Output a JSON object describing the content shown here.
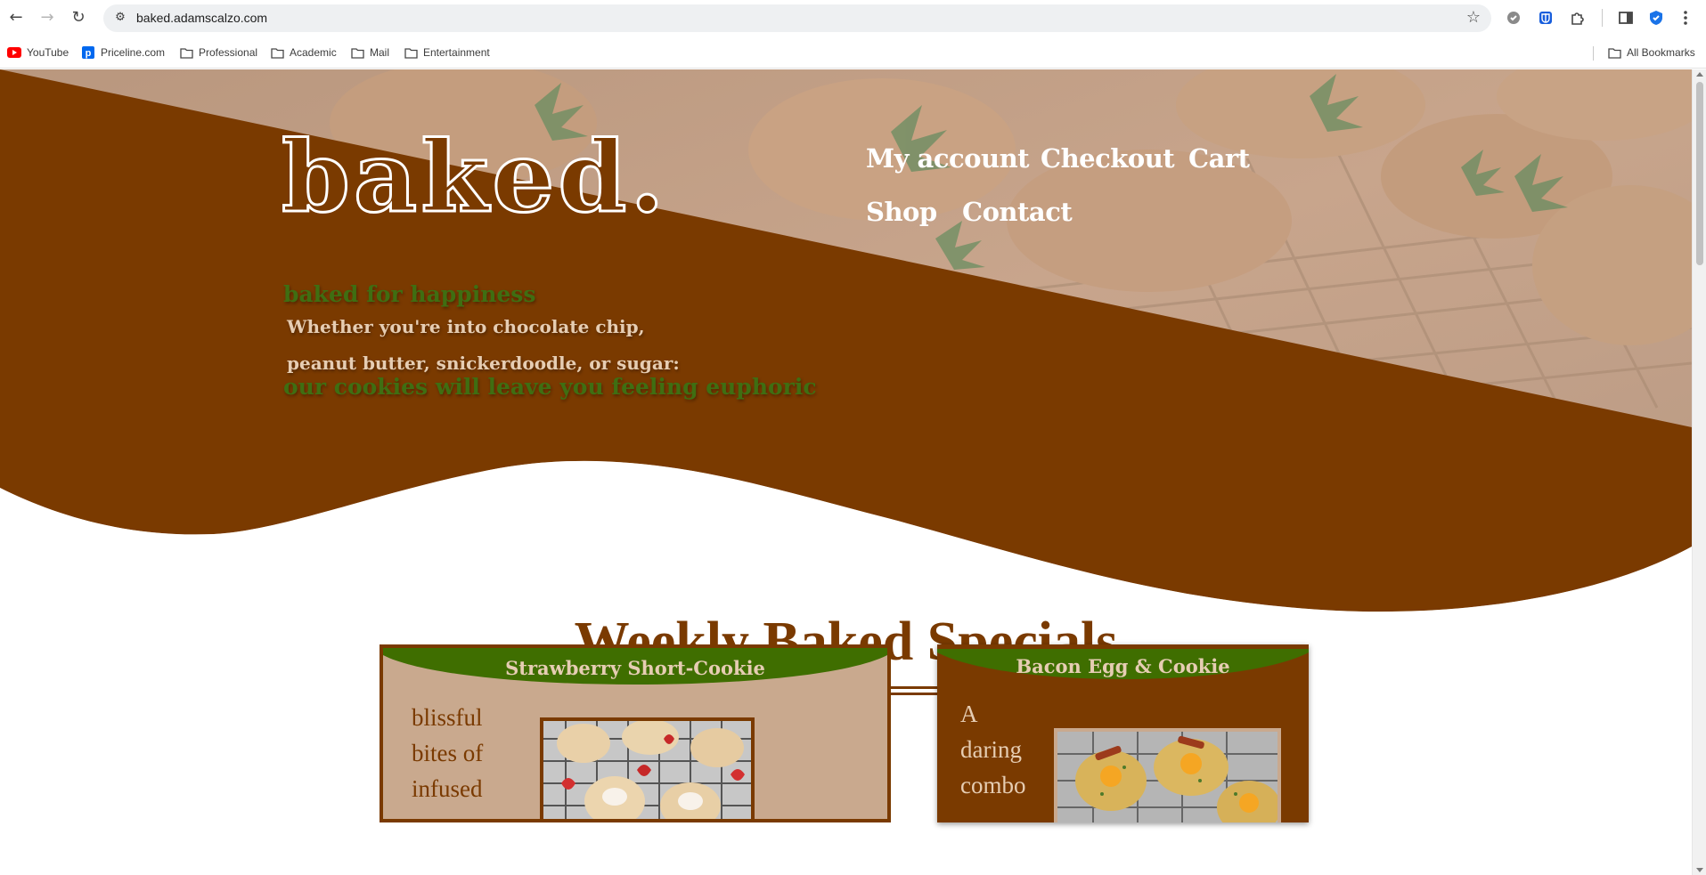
{
  "browser": {
    "url": "baked.adamscalzo.com",
    "bookmarks": [
      {
        "label": "YouTube",
        "icon": "youtube-icon"
      },
      {
        "label": "Priceline.com",
        "icon": "priceline-icon"
      },
      {
        "label": "Professional",
        "icon": "folder-icon"
      },
      {
        "label": "Academic",
        "icon": "folder-icon"
      },
      {
        "label": "Mail",
        "icon": "folder-icon"
      },
      {
        "label": "Entertainment",
        "icon": "folder-icon"
      }
    ],
    "all_bookmarks": "All Bookmarks"
  },
  "site": {
    "logo": "baked.",
    "nav": {
      "my_account": "My account",
      "checkout": "Checkout",
      "cart": "Cart",
      "shop": "Shop",
      "contact": "Contact"
    },
    "tagline": {
      "line1": "baked for happiness",
      "line2": "Whether you're into chocolate chip,",
      "line3": "peanut butter, snickerdoodle, or sugar:",
      "line4": "our cookies will leave you feeling euphoric"
    },
    "specials_title": "Weekly Baked Specials",
    "cards": [
      {
        "title": "Strawberry Short-Cookie",
        "text_lines": [
          "blissful",
          "bites of",
          "infused"
        ]
      },
      {
        "title": "Bacon Egg & Cookie",
        "text_lines": [
          "A",
          "daring",
          "combo"
        ]
      }
    ]
  },
  "colors": {
    "brown": "#7a3a00",
    "green": "#3f6e12",
    "tan": "#c9a98e",
    "cream": "#e6cdb3"
  }
}
